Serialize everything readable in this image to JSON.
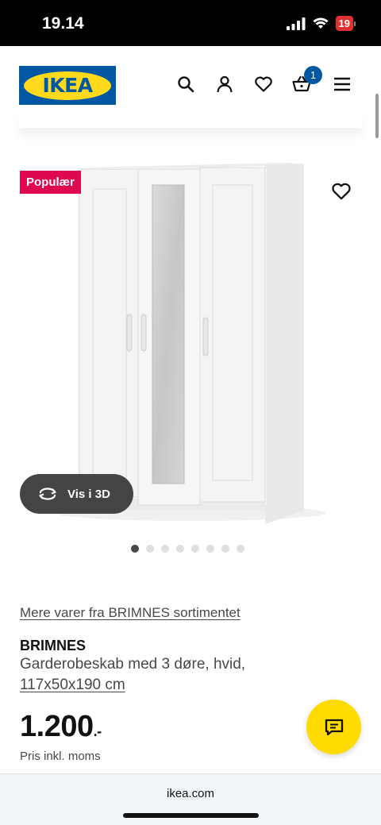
{
  "status_bar": {
    "time": "19.14",
    "battery": "19"
  },
  "header": {
    "logo_text": "IKEA",
    "cart_count": "1",
    "icons": [
      "search-icon",
      "user-icon",
      "heart-icon",
      "basket-icon",
      "menu-icon"
    ]
  },
  "product_image": {
    "badge": "Populær",
    "view_3d_label": "Vis i 3D",
    "image_count": 8,
    "active_image": 1
  },
  "product": {
    "series_link": "Mere varer fra BRIMNES sortimentet",
    "name": "BRIMNES",
    "description": "Garderobeskab med 3 døre, hvid,",
    "measurement": "117x50x190 cm",
    "price_main": "1.200",
    "price_suffix": ".-",
    "price_note": "Pris inkl. moms"
  },
  "browser": {
    "url": "ikea.com"
  },
  "colors": {
    "ikea_blue": "#0058a3",
    "ikea_yellow": "#ffda1a",
    "badge_red": "#e00751",
    "chat_yellow": "#ffdb00"
  }
}
